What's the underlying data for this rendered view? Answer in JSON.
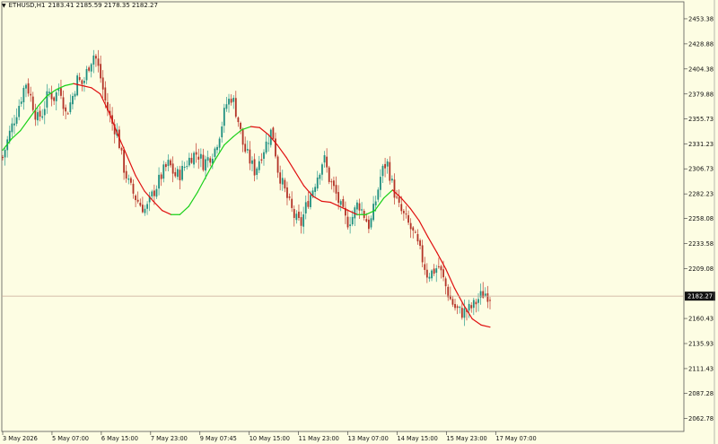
{
  "header": {
    "symbol": "ETHUSD,H1",
    "ohlc": "2183.41 2185.59 2178.35 2182.27",
    "menu_icon": "triangle-down-icon"
  },
  "chart_data": {
    "type": "candlestick",
    "symbol": "ETHUSD",
    "timeframe": "H1",
    "ylim": [
      2050,
      2470
    ],
    "y_ticks": [
      "2453.38",
      "2428.88",
      "2404.38",
      "2379.88",
      "2355.73",
      "2331.23",
      "2306.73",
      "2282.23",
      "2258.08",
      "2233.58",
      "2209.08",
      "2182.27",
      "2160.43",
      "2135.93",
      "2111.43",
      "2087.28",
      "2062.78"
    ],
    "x_ticks": [
      "3 May 2026",
      "5 May 07:00",
      "6 May 15:00",
      "7 May 23:00",
      "9 May 07:45",
      "10 May 15:00",
      "11 May 23:00",
      "13 May 07:00",
      "14 May 15:00",
      "15 May 23:00",
      "17 May 07:00"
    ],
    "current_price": 2182.27,
    "current_price_label": "2182.27",
    "close_path": [
      2318,
      2338,
      2355,
      2372,
      2392,
      2375,
      2355,
      2362,
      2382,
      2376,
      2388,
      2360,
      2374,
      2394,
      2389,
      2408,
      2420,
      2398,
      2370,
      2352,
      2342,
      2310,
      2292,
      2280,
      2272,
      2266,
      2280,
      2292,
      2304,
      2312,
      2300,
      2302,
      2312,
      2320,
      2322,
      2312,
      2318,
      2326,
      2345,
      2370,
      2378,
      2356,
      2328,
      2316,
      2304,
      2320,
      2332,
      2346,
      2306,
      2288,
      2272,
      2258,
      2252,
      2272,
      2286,
      2302,
      2318,
      2296,
      2284,
      2268,
      2254,
      2260,
      2274,
      2262,
      2250,
      2274,
      2302,
      2314,
      2290,
      2270,
      2260,
      2250,
      2238,
      2222,
      2204,
      2206,
      2212,
      2196,
      2180,
      2170,
      2166,
      2168,
      2172,
      2180,
      2186,
      2182
    ],
    "ma_path": [
      2325,
      2336,
      2344,
      2356,
      2368,
      2378,
      2384,
      2388,
      2390,
      2388,
      2386,
      2380,
      2362,
      2340,
      2320,
      2300,
      2285,
      2275,
      2266,
      2262,
      2262,
      2270,
      2284,
      2300,
      2316,
      2330,
      2338,
      2345,
      2348,
      2347,
      2340,
      2330,
      2318,
      2304,
      2290,
      2280,
      2275,
      2274,
      2270,
      2266,
      2262,
      2262,
      2266,
      2278,
      2286,
      2278,
      2268,
      2256,
      2240,
      2225,
      2209,
      2190,
      2174,
      2160,
      2154,
      2152
    ],
    "ma_rising_color": "#19d019",
    "ma_falling_color": "#e01010",
    "bull_color": "#2a9d8f",
    "bear_color": "#c0392b",
    "price_line_color": "#c8a896",
    "background": "#fdfde3"
  }
}
